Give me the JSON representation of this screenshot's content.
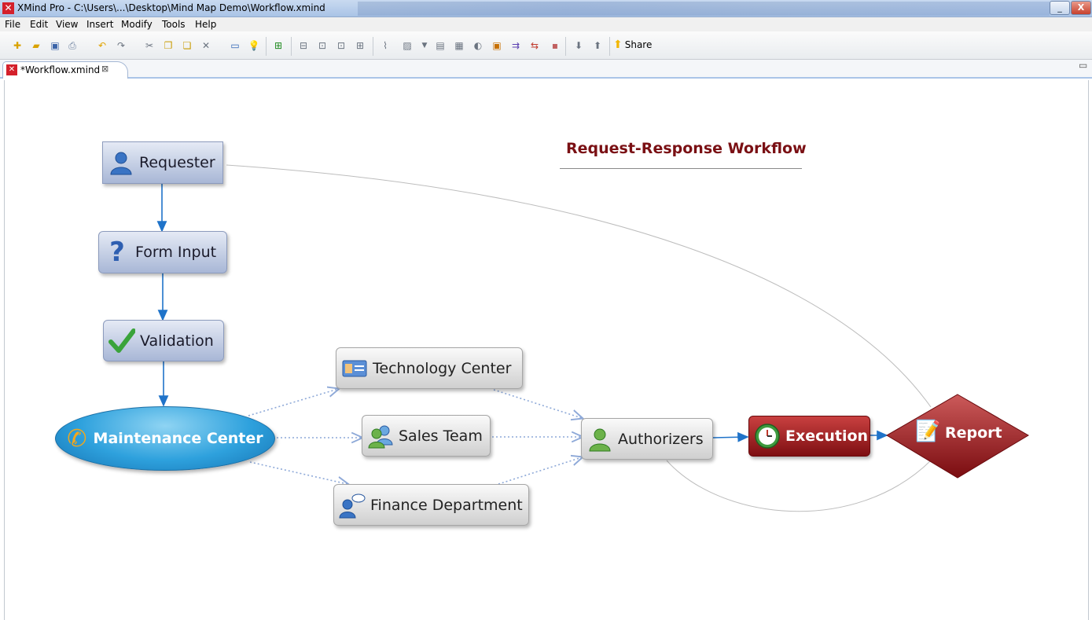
{
  "window": {
    "title": "XMind Pro - C:\\Users\\...\\Desktop\\Mind Map Demo\\Workflow.xmind",
    "minimize_label": "_",
    "close_label": "X"
  },
  "menu": {
    "items": [
      "File",
      "Edit",
      "View",
      "Insert",
      "Modify",
      "Tools",
      "Help"
    ]
  },
  "toolbar": {
    "share_label": "Share"
  },
  "tabs": {
    "active_label": "*Workflow.xmind",
    "close_glyph": "⊠"
  },
  "map": {
    "title": "Request-Response Workflow",
    "central": {
      "label": "Maintenance Center",
      "icon": "phone-icon"
    },
    "topics": {
      "requester": {
        "label": "Requester",
        "icon": "user-icon"
      },
      "form_input": {
        "label": "Form Input",
        "icon": "question-icon"
      },
      "validation": {
        "label": "Validation",
        "icon": "checkmark-icon"
      },
      "technology_center": {
        "label": "Technology Center",
        "icon": "id-card-icon"
      },
      "sales_team": {
        "label": "Sales Team",
        "icon": "group-icon"
      },
      "finance_department": {
        "label": "Finance Department",
        "icon": "users-chat-icon"
      },
      "authorizers": {
        "label": "Authorizers",
        "icon": "user-icon"
      },
      "execution": {
        "label": "Execution",
        "icon": "clock-icon"
      },
      "report": {
        "label": "Report",
        "icon": "clipboard-icon"
      }
    },
    "colors": {
      "primary_arrow": "#1f73c9",
      "dotted_connector": "#8ea9d8",
      "curve": "#b8b8b8",
      "title": "#7a1014",
      "central_fill": "#2ea1dd",
      "red_fill": "#8f1a1d"
    }
  }
}
